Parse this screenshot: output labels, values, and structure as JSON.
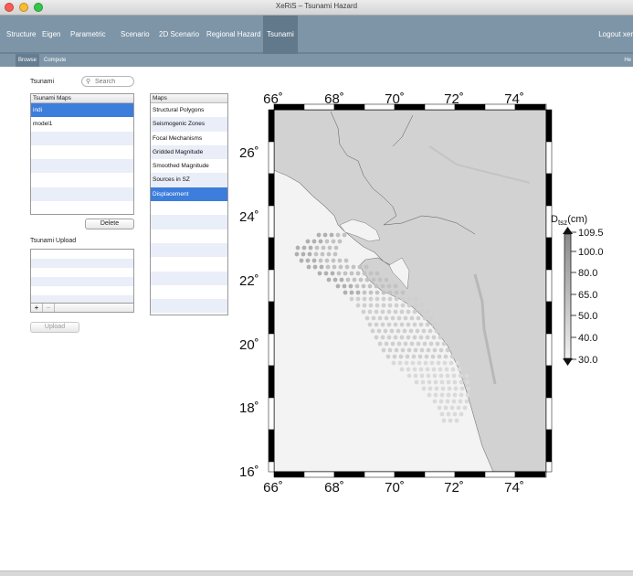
{
  "window": {
    "title": "XeRiS – Tsunami Hazard"
  },
  "mainnav": {
    "items": [
      "Structure",
      "Eigen",
      "Parametric",
      "Scenario",
      "2D Scenario",
      "Regional Hazard",
      "Tsunami"
    ],
    "active": "Tsunami",
    "logout": "Logout xer"
  },
  "subnav": {
    "items": [
      "Browse",
      "Compute"
    ],
    "active": "Browse",
    "help": "He"
  },
  "left": {
    "section_label": "Tsunami",
    "search_placeholder": "Search",
    "tsunami_maps": {
      "header": "Tsunami Maps",
      "items": [
        "indi",
        "model1"
      ],
      "selected": "indi"
    },
    "maps": {
      "header": "Maps",
      "items": [
        "Structural Polygons",
        "Seismogenic Zones",
        "Focal Mechanisms",
        "Gridded Magnitude",
        "Smoothed Magnitude",
        "Sources in SZ",
        "Displacement"
      ],
      "selected": "Displacement"
    },
    "delete_label": "Delete",
    "upload_section_label": "Tsunami Upload",
    "add_symbol": "+",
    "remove_symbol": "−",
    "upload_label": "Upload"
  },
  "map": {
    "lon_ticks": [
      "66˚",
      "68˚",
      "70˚",
      "72˚",
      "74˚"
    ],
    "lat_ticks": [
      "26˚",
      "24˚",
      "22˚",
      "20˚",
      "18˚",
      "16˚"
    ],
    "colorbar": {
      "title_main": "D",
      "title_sub": "tsz",
      "title_unit": "(cm)",
      "ticks": [
        "109.5",
        "100.0",
        "80.0",
        "65.0",
        "50.0",
        "40.0",
        "30.0"
      ]
    },
    "colors": {
      "land": "#d2d2d2",
      "sea": "#f3f3f3"
    }
  }
}
